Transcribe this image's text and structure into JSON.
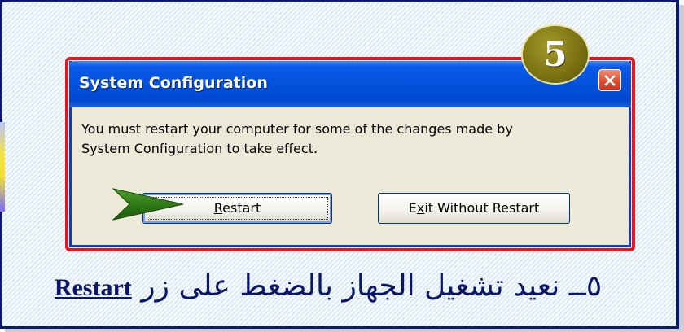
{
  "badge": {
    "step_number": "5"
  },
  "dialog": {
    "title": "System Configuration",
    "close_label": "close",
    "message_line1": "You must restart your computer for some of the changes made by",
    "message_line2": "System Configuration to take effect.",
    "buttons": {
      "restart": {
        "label_mnemonic": "R",
        "label_rest": "estart"
      },
      "exit": {
        "label_start": "E",
        "label_mnemonic": "x",
        "label_rest": "it Without Restart"
      }
    }
  },
  "caption": {
    "text": "٥ــ نعيد تشغيل الجهاز بالضغط على زر",
    "button_name": "Restart"
  },
  "colors": {
    "frame_border": "#0b1a6e",
    "highlight_border": "#e8141c",
    "titlebar_blue": "#0352dc",
    "caption_text": "#0b1666",
    "arrow_green": "#2f7a18",
    "badge_olive": "#7c7312"
  },
  "icons": {
    "close": "close-x-icon",
    "pointer": "green-arrow-pointer-icon"
  }
}
